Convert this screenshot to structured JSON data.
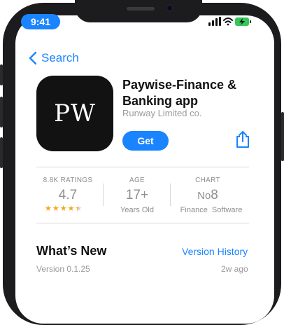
{
  "status_bar": {
    "time": "9:41"
  },
  "nav": {
    "back_label": "Search"
  },
  "app": {
    "icon_text": "PW",
    "name_line1": "Paywise-Finance &",
    "name_line2": "Banking app",
    "developer": "Runway Limited co.",
    "get_label": "Get"
  },
  "stats": {
    "ratings": {
      "label": "8.8K RATINGS",
      "value": "4.7",
      "stars": 4.5
    },
    "age": {
      "label": "AGE",
      "value": "17+",
      "sub": "Years Old"
    },
    "chart": {
      "label": "CHART",
      "value_prefix": "No",
      "value_rank": "8",
      "sub": "Finance  Software"
    }
  },
  "whats_new": {
    "title": "What’s New",
    "history_link": "Version History",
    "version": "Version 0.1.25",
    "date": "2w ago"
  },
  "colors": {
    "accent": "#1a84ff",
    "star": "#f5a623",
    "battery": "#34c759"
  }
}
